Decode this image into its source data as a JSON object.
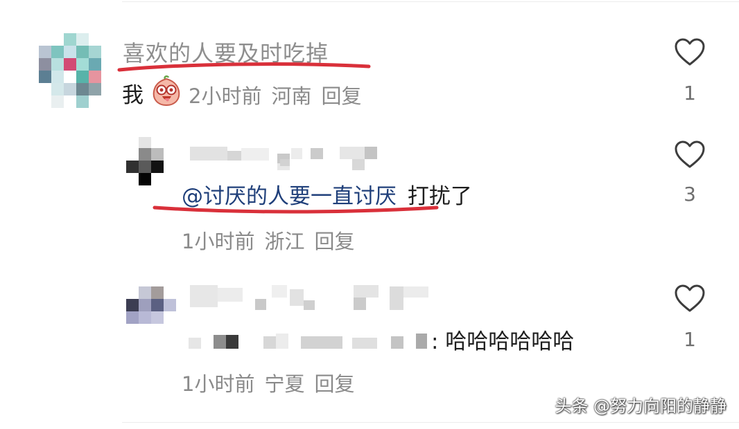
{
  "comments": [
    {
      "username": "喜欢的人要及时吃掉",
      "text": "我",
      "emoji_icon": "blushing-face-sticker-icon",
      "time": "2小时前",
      "location": "河南",
      "reply_label": "回复",
      "likes": "1"
    },
    {
      "mention": "@讨厌的人要一直讨厌",
      "text": "打扰了",
      "time": "1小时前",
      "location": "浙江",
      "reply_label": "回复",
      "likes": "3"
    },
    {
      "text": ": 哈哈哈哈哈哈",
      "time": "1小时前",
      "location": "宁夏",
      "reply_label": "回复",
      "likes": "1"
    }
  ],
  "watermark": "头条 @努力向阳的静静",
  "colors": {
    "underline": "#d9303a",
    "mention": "#1f3f7a",
    "meta": "#8a8a8a"
  },
  "icons": {
    "like": "heart-outline-icon"
  }
}
